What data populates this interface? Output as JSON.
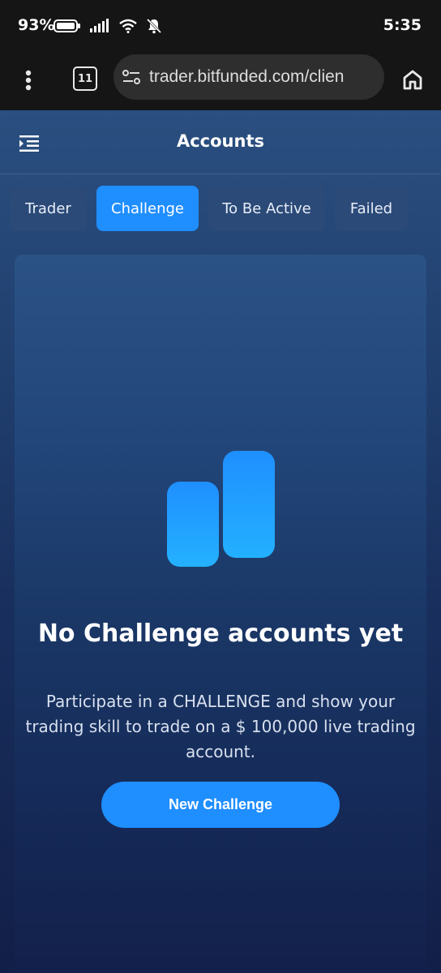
{
  "status_bar": {
    "battery": "93%",
    "time": "5:35"
  },
  "browser": {
    "tab_count": "11",
    "url": "trader.bitfunded.com/clien"
  },
  "header": {
    "title": "Accounts"
  },
  "tabs": [
    {
      "label": "Trader"
    },
    {
      "label": "Challenge"
    },
    {
      "label": "To Be Active"
    },
    {
      "label": "Failed"
    }
  ],
  "empty_state": {
    "title": "No Challenge accounts yet",
    "description": "Participate in a CHALLENGE and show your trading skill to trade on a $ 100,000 live trading account.",
    "button_label": "New Challenge"
  },
  "colors": {
    "accent": "#1f8eff",
    "tab_inactive": "#2b4a78",
    "background": "#13224a"
  }
}
